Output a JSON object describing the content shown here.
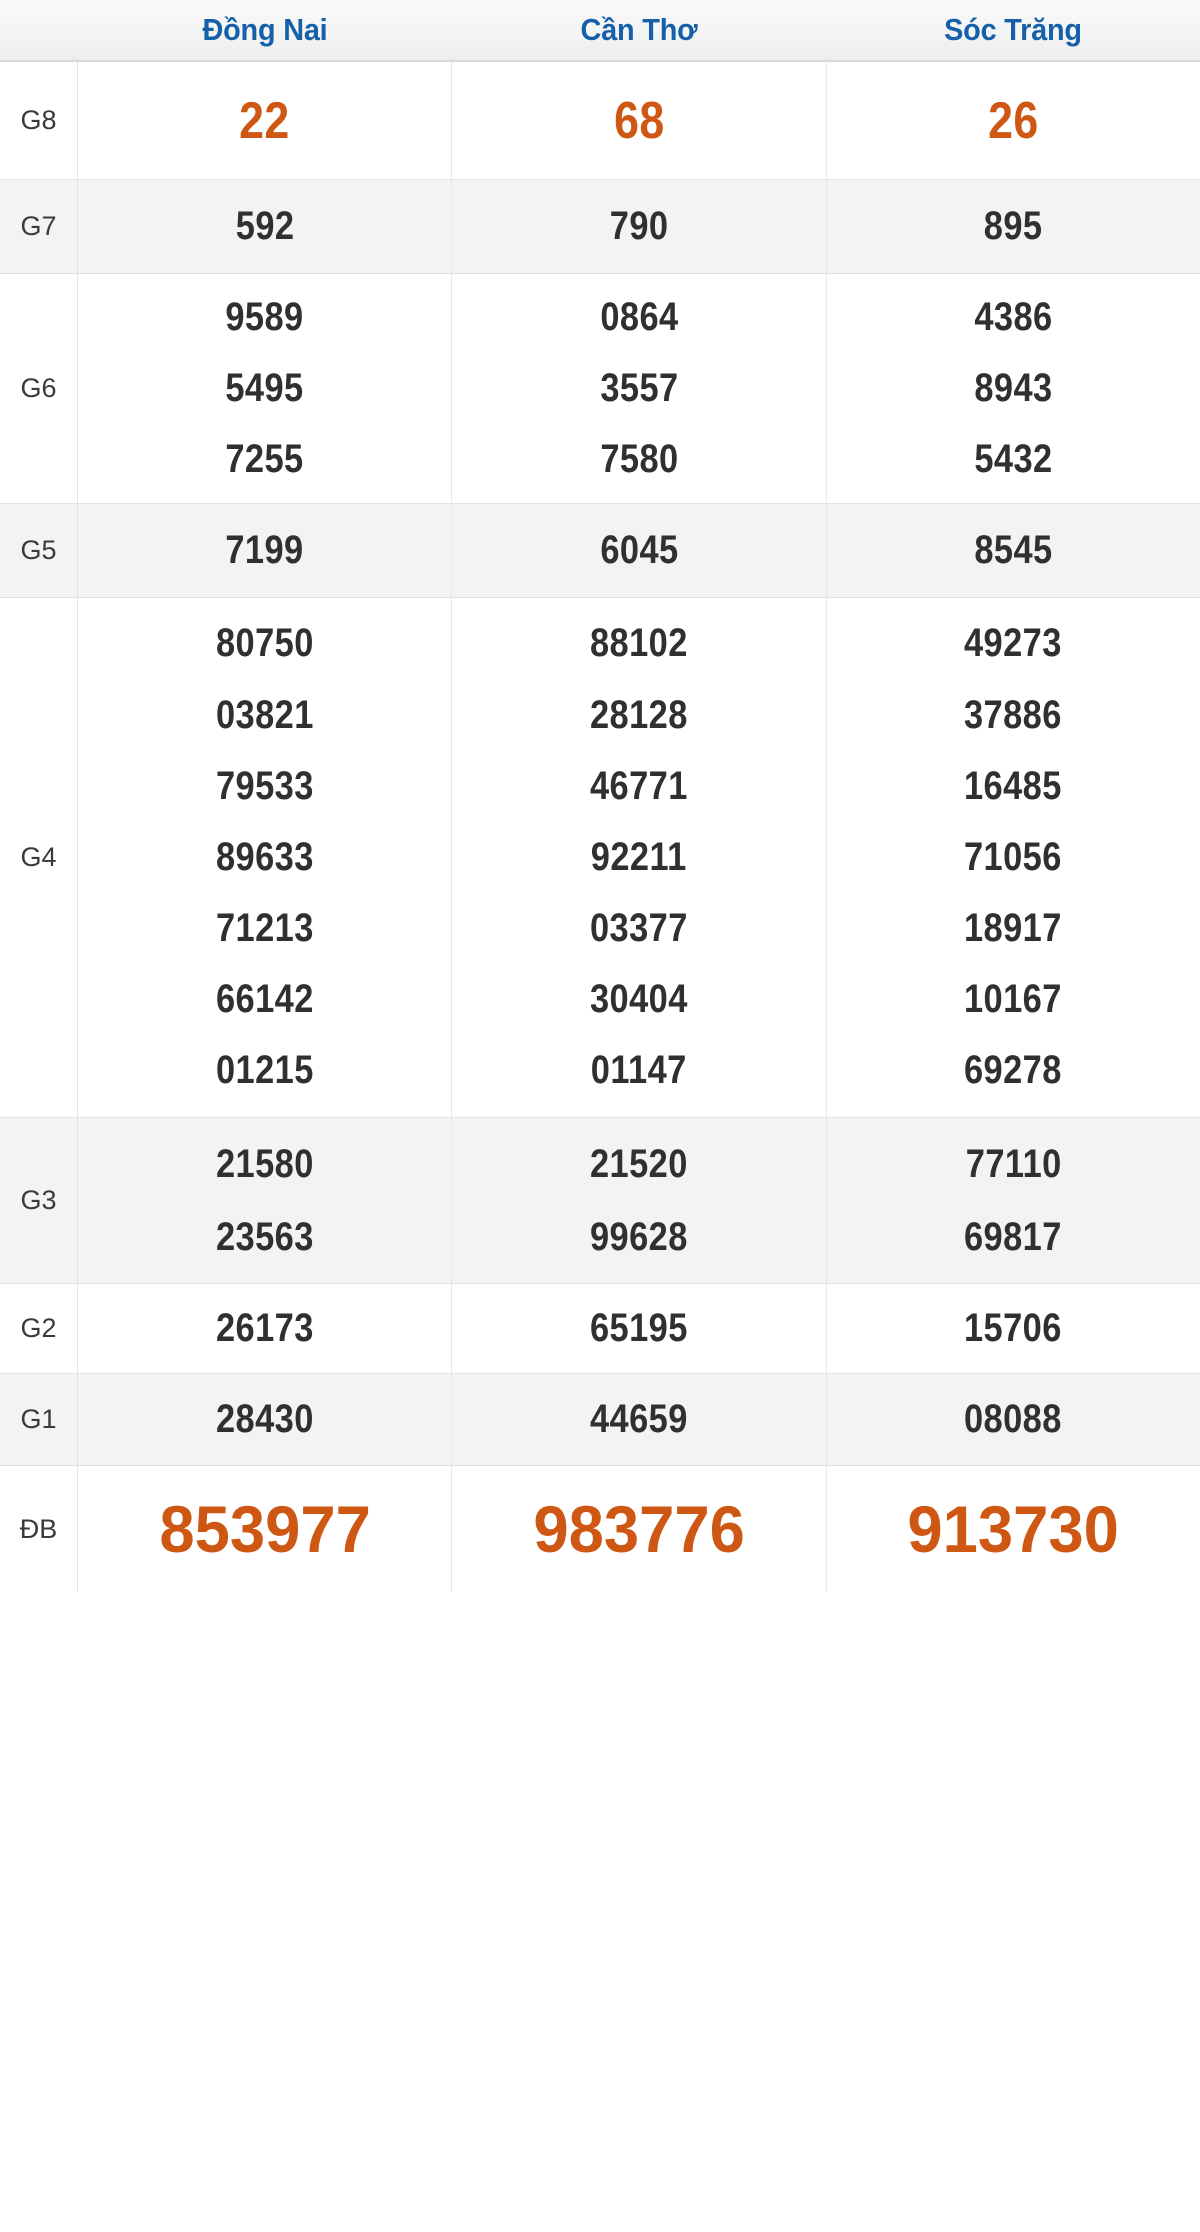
{
  "table": {
    "label_column_header": "",
    "provinces": [
      "Đồng Nai",
      "Cần Thơ",
      "Sóc Trăng"
    ],
    "colors": {
      "header_text": "#1560a8",
      "highlight_number": "#cf5714",
      "normal_number": "#303030",
      "row_alt_background": "#f3f3f3",
      "row_background": "#ffffff",
      "border": "#e3e3e3"
    },
    "rows": [
      {
        "label": "G8",
        "highlight": true,
        "shaded": false,
        "values": [
          [
            "22"
          ],
          [
            "68"
          ],
          [
            "26"
          ]
        ]
      },
      {
        "label": "G7",
        "highlight": false,
        "shaded": true,
        "values": [
          [
            "592"
          ],
          [
            "790"
          ],
          [
            "895"
          ]
        ]
      },
      {
        "label": "G6",
        "highlight": false,
        "shaded": false,
        "values": [
          [
            "9589",
            "5495",
            "7255"
          ],
          [
            "0864",
            "3557",
            "7580"
          ],
          [
            "4386",
            "8943",
            "5432"
          ]
        ]
      },
      {
        "label": "G5",
        "highlight": false,
        "shaded": true,
        "values": [
          [
            "7199"
          ],
          [
            "6045"
          ],
          [
            "8545"
          ]
        ]
      },
      {
        "label": "G4",
        "highlight": false,
        "shaded": false,
        "values": [
          [
            "80750",
            "03821",
            "79533",
            "89633",
            "71213",
            "66142",
            "01215"
          ],
          [
            "88102",
            "28128",
            "46771",
            "92211",
            "03377",
            "30404",
            "01147"
          ],
          [
            "49273",
            "37886",
            "16485",
            "71056",
            "18917",
            "10167",
            "69278"
          ]
        ]
      },
      {
        "label": "G3",
        "highlight": false,
        "shaded": true,
        "values": [
          [
            "21580",
            "23563"
          ],
          [
            "21520",
            "99628"
          ],
          [
            "77110",
            "69817"
          ]
        ]
      },
      {
        "label": "G2",
        "highlight": false,
        "shaded": false,
        "values": [
          [
            "26173"
          ],
          [
            "65195"
          ],
          [
            "15706"
          ]
        ]
      },
      {
        "label": "G1",
        "highlight": false,
        "shaded": true,
        "values": [
          [
            "28430"
          ],
          [
            "44659"
          ],
          [
            "08088"
          ]
        ]
      },
      {
        "label": "ĐB",
        "highlight": true,
        "shaded": false,
        "values": [
          [
            "853977"
          ],
          [
            "983776"
          ],
          [
            "913730"
          ]
        ]
      }
    ]
  }
}
